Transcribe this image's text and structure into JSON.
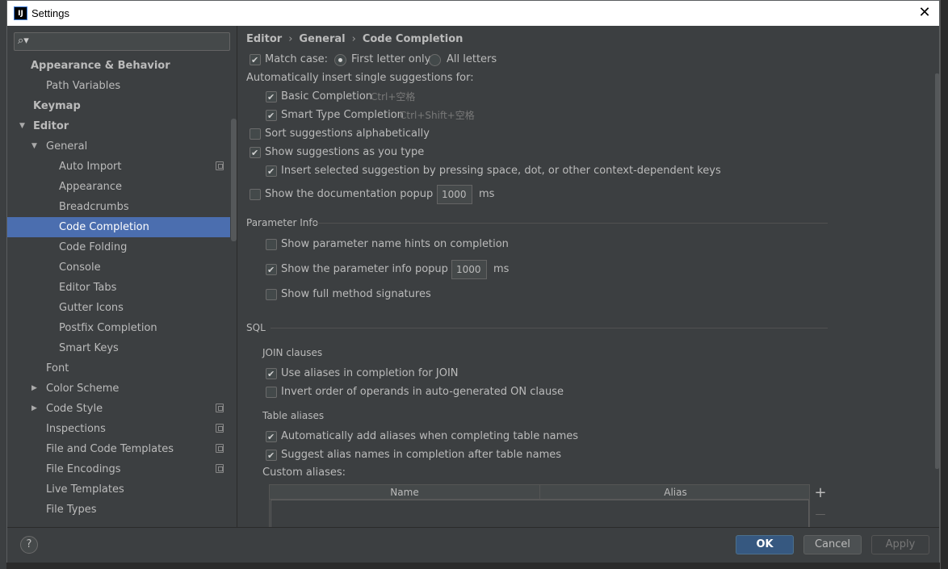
{
  "window": {
    "title": "Settings",
    "app_icon_text": "IJ"
  },
  "search": {
    "placeholder": "",
    "value": ""
  },
  "tree": [
    {
      "label": "Appearance & Behavior",
      "bold": true,
      "arrow": "",
      "indent": 1,
      "icon": false,
      "selected": false
    },
    {
      "label": "Path Variables",
      "bold": false,
      "arrow": "",
      "indent": 2,
      "icon": false,
      "selected": false
    },
    {
      "label": "Keymap",
      "bold": true,
      "arrow": "",
      "indent": 1,
      "icon": false,
      "selected": false
    },
    {
      "label": "Editor",
      "bold": true,
      "arrow": "down",
      "indent": 1,
      "icon": false,
      "selected": false
    },
    {
      "label": "General",
      "bold": false,
      "arrow": "down",
      "indent": 2,
      "icon": false,
      "selected": false
    },
    {
      "label": "Auto Import",
      "bold": false,
      "arrow": "",
      "indent": 3,
      "icon": true,
      "selected": false
    },
    {
      "label": "Appearance",
      "bold": false,
      "arrow": "",
      "indent": 3,
      "icon": false,
      "selected": false
    },
    {
      "label": "Breadcrumbs",
      "bold": false,
      "arrow": "",
      "indent": 3,
      "icon": false,
      "selected": false
    },
    {
      "label": "Code Completion",
      "bold": false,
      "arrow": "",
      "indent": 3,
      "icon": false,
      "selected": true
    },
    {
      "label": "Code Folding",
      "bold": false,
      "arrow": "",
      "indent": 3,
      "icon": false,
      "selected": false
    },
    {
      "label": "Console",
      "bold": false,
      "arrow": "",
      "indent": 3,
      "icon": false,
      "selected": false
    },
    {
      "label": "Editor Tabs",
      "bold": false,
      "arrow": "",
      "indent": 3,
      "icon": false,
      "selected": false
    },
    {
      "label": "Gutter Icons",
      "bold": false,
      "arrow": "",
      "indent": 3,
      "icon": false,
      "selected": false
    },
    {
      "label": "Postfix Completion",
      "bold": false,
      "arrow": "",
      "indent": 3,
      "icon": false,
      "selected": false
    },
    {
      "label": "Smart Keys",
      "bold": false,
      "arrow": "",
      "indent": 3,
      "icon": false,
      "selected": false
    },
    {
      "label": "Font",
      "bold": false,
      "arrow": "",
      "indent": 2,
      "icon": false,
      "selected": false
    },
    {
      "label": "Color Scheme",
      "bold": false,
      "arrow": "right",
      "indent": 2,
      "icon": false,
      "selected": false
    },
    {
      "label": "Code Style",
      "bold": false,
      "arrow": "right",
      "indent": 2,
      "icon": true,
      "selected": false
    },
    {
      "label": "Inspections",
      "bold": false,
      "arrow": "",
      "indent": 2,
      "icon": true,
      "selected": false
    },
    {
      "label": "File and Code Templates",
      "bold": false,
      "arrow": "",
      "indent": 2,
      "icon": true,
      "selected": false
    },
    {
      "label": "File Encodings",
      "bold": false,
      "arrow": "",
      "indent": 2,
      "icon": true,
      "selected": false
    },
    {
      "label": "Live Templates",
      "bold": false,
      "arrow": "",
      "indent": 2,
      "icon": false,
      "selected": false
    },
    {
      "label": "File Types",
      "bold": false,
      "arrow": "",
      "indent": 2,
      "icon": false,
      "selected": false
    }
  ],
  "breadcrumb": [
    "Editor",
    "General",
    "Code Completion"
  ],
  "completion": {
    "match_case": {
      "label": "Match case:",
      "checked": true
    },
    "first_letter_only": {
      "label": "First letter only",
      "selected": true
    },
    "all_letters": {
      "label": "All letters",
      "selected": false
    },
    "auto_insert_heading": "Automatically insert single suggestions for:",
    "basic_completion": {
      "label": "Basic Completion",
      "shortcut": "Ctrl+空格",
      "checked": true
    },
    "smart_type_completion": {
      "label": "Smart Type Completion",
      "shortcut": "Ctrl+Shift+空格",
      "checked": true
    },
    "sort_alpha": {
      "label": "Sort suggestions alphabetically",
      "checked": false
    },
    "show_as_you_type": {
      "label": "Show suggestions as you type",
      "checked": true
    },
    "insert_selected": {
      "label": "Insert selected suggestion by pressing space, dot, or other context-dependent keys",
      "checked": true
    },
    "doc_popup": {
      "label": "Show the documentation popup in",
      "value": "1000",
      "unit": "ms",
      "checked": false
    }
  },
  "parameter_info": {
    "title": "Parameter Info",
    "name_hints": {
      "label": "Show parameter name hints on completion",
      "checked": false
    },
    "info_popup": {
      "label": "Show the parameter info popup in",
      "value": "1000",
      "unit": "ms",
      "checked": true
    },
    "full_signatures": {
      "label": "Show full method signatures",
      "checked": false
    }
  },
  "sql": {
    "title": "SQL",
    "join_title": "JOIN clauses",
    "use_aliases_join": {
      "label": "Use aliases in completion for JOIN",
      "checked": true
    },
    "invert_order": {
      "label": "Invert order of operands in auto-generated ON clause",
      "checked": false
    },
    "table_aliases_title": "Table aliases",
    "auto_add_aliases": {
      "label": "Automatically add aliases when completing table names",
      "checked": true
    },
    "suggest_alias_names": {
      "label": "Suggest alias names in completion after table names",
      "checked": true
    },
    "custom_aliases_label": "Custom aliases:",
    "table_columns": [
      "Name",
      "Alias"
    ],
    "add_symbol": "+",
    "remove_symbol": "—"
  },
  "buttons": {
    "help": "?",
    "ok": "OK",
    "cancel": "Cancel",
    "apply": "Apply"
  },
  "colors": {
    "background": "#3c3f41",
    "selection": "#4b6eaf",
    "primary_button": "#365880"
  }
}
